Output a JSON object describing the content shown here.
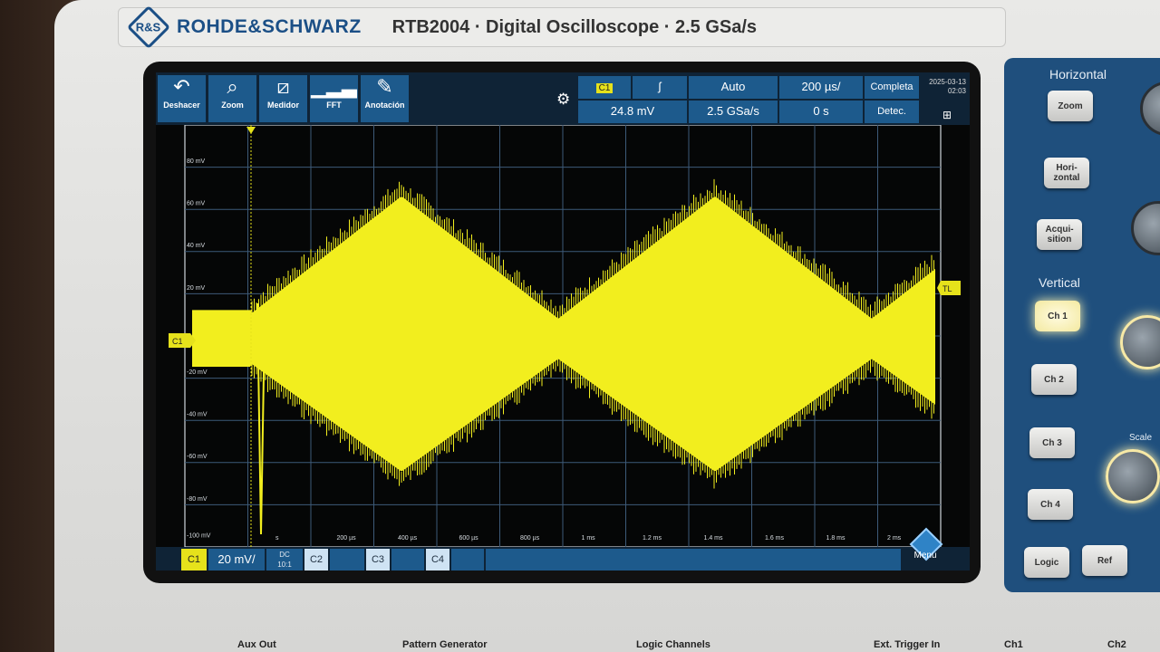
{
  "brand": {
    "logo": "R&S",
    "name": "ROHDE&SCHWARZ",
    "model": "RTB2004 · Digital Oscilloscope · 2.5 GSa/s"
  },
  "toolbar": {
    "tools": [
      {
        "label": "Deshacer",
        "icon": "undo-icon"
      },
      {
        "label": "Zoom",
        "icon": "zoom-icon"
      },
      {
        "label": "Medidor",
        "icon": "meter-icon"
      },
      {
        "label": "FFT",
        "icon": "fft-icon"
      },
      {
        "label": "Anotación",
        "icon": "pencil-icon"
      }
    ],
    "trigger_source": "C1",
    "trigger_edge": "ʃ",
    "trigger_level": "24.8 mV",
    "trigger_mode": "Auto",
    "sample_rate": "2.5 GSa/s",
    "time_scale": "200 µs/",
    "time_offset": "0 s",
    "acq_mode_top": "Completa",
    "acq_mode": "Detec. picos",
    "date": "2025-03-13",
    "time": "02:03"
  },
  "grid": {
    "y_labels": [
      "80 mV",
      "60 mV",
      "40 mV",
      "20 mV",
      "",
      "-20 mV",
      "-40 mV",
      "-60 mV",
      "-80 mV",
      "-100 mV"
    ],
    "x_labels": [
      "s",
      "200 µs",
      "400 µs",
      "600 µs",
      "800 µs",
      "1 ms",
      "1.2 ms",
      "1.4 ms",
      "1.6 ms",
      "1.8 ms",
      "2 ms"
    ],
    "ch_marker": "C1",
    "trigger_marker": "TL"
  },
  "bottom": {
    "ch1": "C1",
    "ch1_scale": "20 mV/",
    "ch1_coupling": "DC",
    "ch1_probe": "10:1",
    "ch2": "C2",
    "ch3": "C3",
    "ch4": "C4",
    "menu": "Menu"
  },
  "panel": {
    "horizontal_title": "Horizontal",
    "zoom": "Zoom",
    "horizontal": "Hori-zontal",
    "acquisition": "Acqui-sition",
    "vertical_title": "Vertical",
    "ch1": "Ch 1",
    "ch2": "Ch 2",
    "ch3": "Ch 3",
    "ch4": "Ch 4",
    "scale": "Scale",
    "logic": "Logic",
    "ref": "Ref"
  },
  "front_labels": {
    "aux_out": "Aux Out",
    "pattern": "Pattern Generator",
    "logic_channels": "Logic Channels",
    "ext_trigger": "Ext. Trigger In",
    "ch1": "Ch1",
    "ch2": "Ch2"
  },
  "colors": {
    "trace": "#f2ee1e",
    "accent": "#1d5a8c",
    "brand": "#1b4f86"
  }
}
